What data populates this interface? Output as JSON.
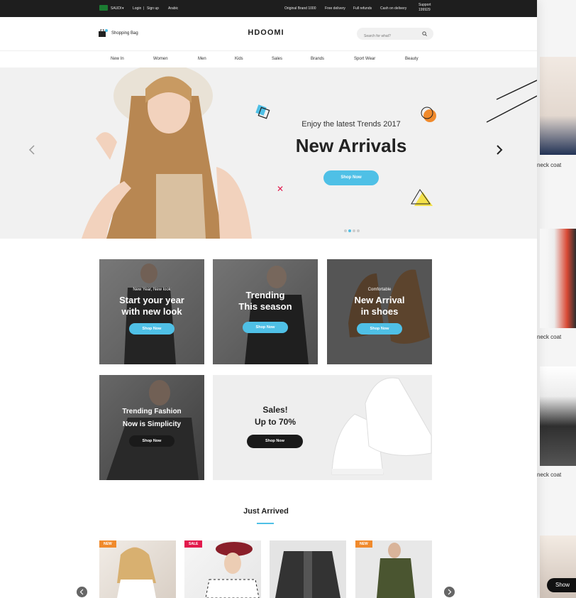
{
  "topbar": {
    "country": "SAUDI",
    "login": "Login",
    "signup": "Sign up",
    "language": "Arabic",
    "original_brand": "Original Brand 1000",
    "free_delivery": "Free delivery",
    "full_refunds": "Full refunds",
    "cash_on_delivery": "Cash on delivery",
    "support_label": "Support",
    "support_number": "199929"
  },
  "header": {
    "bag_label": "Shopping Bag",
    "logo": "HDOOMI",
    "search_placeholder": "Search for what?"
  },
  "nav": [
    "New In",
    "Women",
    "Men",
    "Kids",
    "Sales",
    "Brands",
    "Sport Wear",
    "Beauty"
  ],
  "hero": {
    "subtitle": "Enjoy the latest Trends 2017",
    "title": "New Arrivals",
    "button": "Shop Now",
    "slides": 3,
    "active_slide": 2
  },
  "tiles": [
    {
      "small": "New Year, New look",
      "big1": "Start your year",
      "big2": "with new look",
      "button": "Shop Now"
    },
    {
      "small": "",
      "big1": "Trending",
      "big2": "This season",
      "button": "Shop Now"
    },
    {
      "small": "Comfortable",
      "big1": "New Arrival",
      "big2": "in shoes",
      "button": "Shop Now"
    },
    {
      "small": "",
      "big1": "Trending Fashion",
      "big2": "Now is Simplicity",
      "button": "Shop Now"
    },
    {
      "small": "",
      "big1": "Sales!",
      "big2": "Up to 70%",
      "button": "Shop Now"
    }
  ],
  "section": {
    "title": "Just Arrived"
  },
  "products": [
    {
      "badge": "NEW",
      "badge_color": "#f08a2c"
    },
    {
      "badge": "SALE",
      "badge_color": "#e2194c"
    },
    {
      "badge": "",
      "badge_color": ""
    },
    {
      "badge": "NEW",
      "badge_color": "#f08a2c"
    }
  ],
  "peek": {
    "label": "neck coat",
    "button": "Show"
  },
  "colors": {
    "accent": "#4fc0e6",
    "topbar": "#1e1e1e"
  }
}
